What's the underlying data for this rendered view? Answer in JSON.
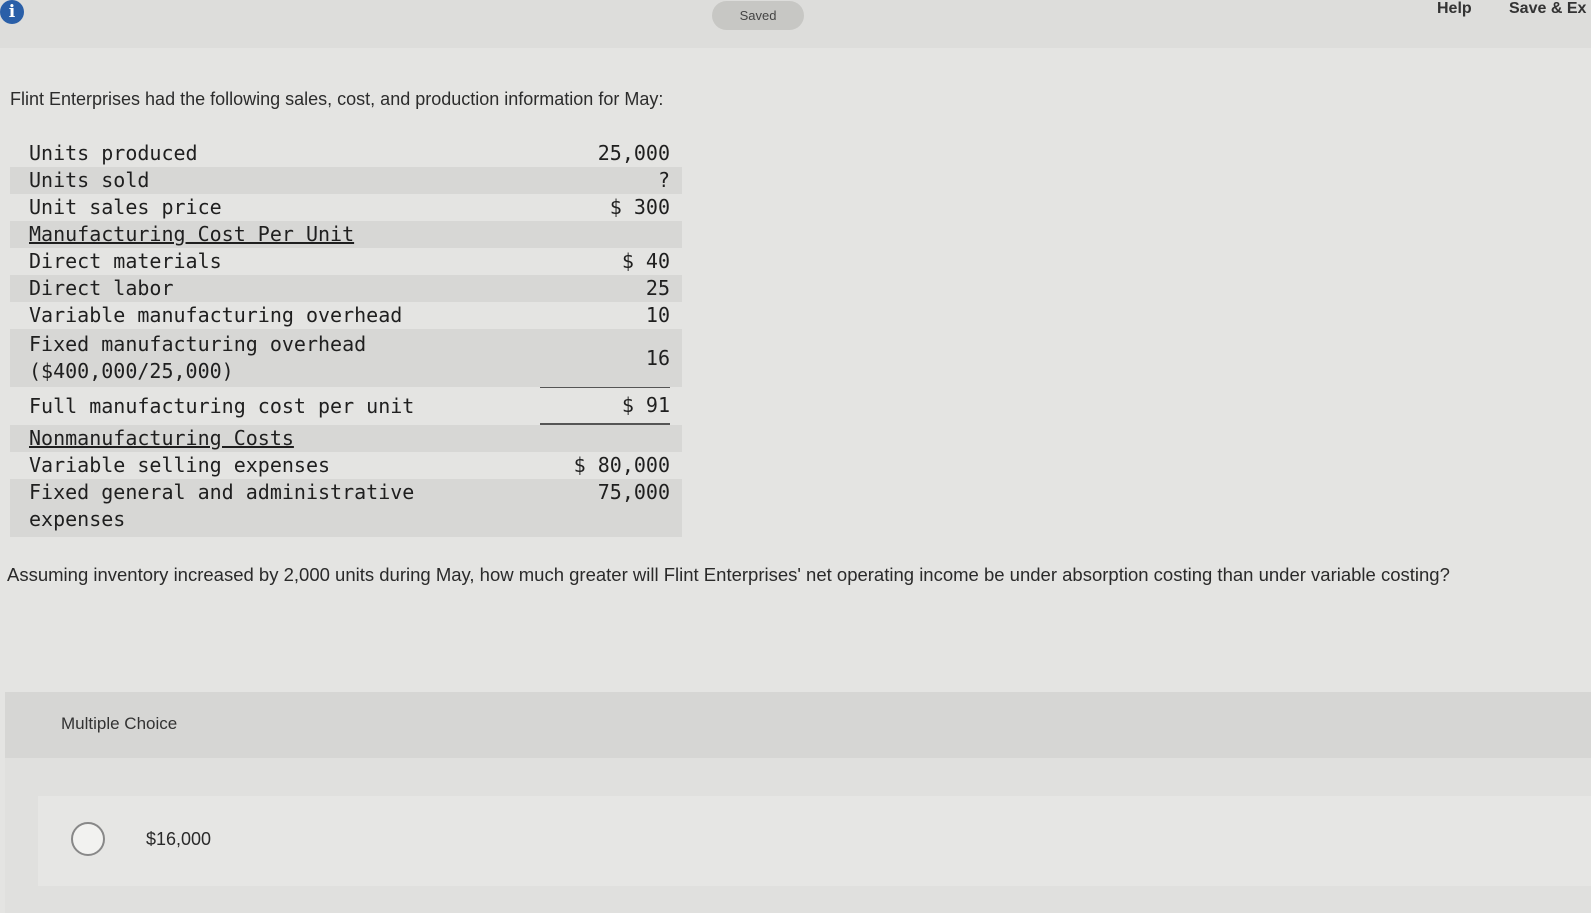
{
  "header": {
    "info_icon_glyph": "i",
    "status_label": "Saved",
    "help_label": "Help",
    "save_exit_label": "Save & Ex"
  },
  "intro": "Flint Enterprises had the following sales, cost, and production information for May:",
  "table": {
    "units_produced": {
      "label": "Units produced",
      "value": "25,000"
    },
    "units_sold": {
      "label": "Units sold",
      "value": "?"
    },
    "unit_sales_price": {
      "label": "Unit sales price",
      "value": "$ 300"
    },
    "mfg_heading": "Manufacturing Cost Per Unit",
    "direct_materials": {
      "label": "Direct materials",
      "value": "$ 40"
    },
    "direct_labor": {
      "label": "Direct labor",
      "value": "25"
    },
    "variable_overhead": {
      "label": "Variable manufacturing overhead",
      "value": "10"
    },
    "fixed_overhead": {
      "label": "Fixed manufacturing overhead\n($400,000/25,000)",
      "value": "16"
    },
    "full_cost": {
      "label": "Full manufacturing cost per unit",
      "value": "$ 91"
    },
    "nonmfg_heading": "Nonmanufacturing Costs",
    "variable_selling": {
      "label": "Variable selling expenses",
      "value": "$ 80,000"
    },
    "fixed_ga": {
      "label": "Fixed general and administrative\nexpenses",
      "value": "75,000"
    }
  },
  "question": "Assuming inventory increased by 2,000 units during May, how much greater will Flint Enterprises' net operating income be under absorption costing than under variable costing?",
  "multiple_choice": {
    "label": "Multiple Choice",
    "options": [
      {
        "text": "$16,000"
      }
    ]
  }
}
